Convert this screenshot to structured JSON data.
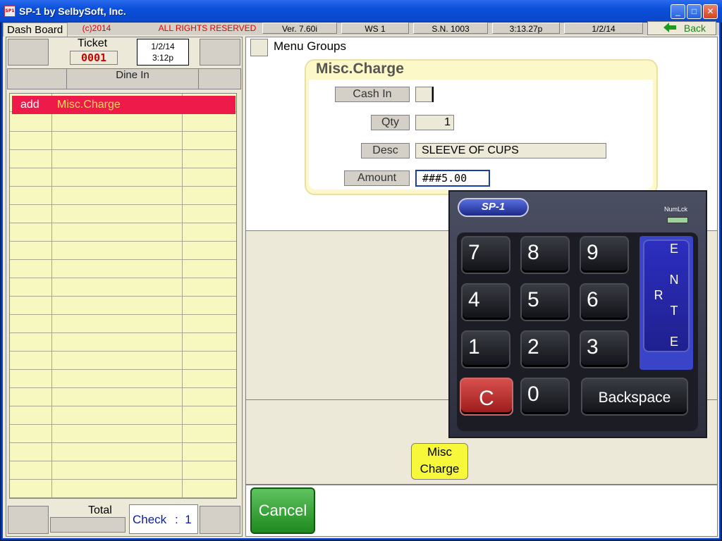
{
  "window": {
    "title": "SP-1 by SelbySoft, Inc.",
    "icon_text": "SP1",
    "minimize": "_",
    "maximize": "□",
    "close": "✕"
  },
  "statusbar": {
    "tab": "Dash Board",
    "copyright": "(c)2014",
    "rights": "ALL RIGHTS RESERVED",
    "version": "Ver. 7.60i",
    "workstation": "WS  1",
    "serial": "S.N. 1003",
    "time": "3:13.27p",
    "date": "1/2/14",
    "back": "Back"
  },
  "ticket": {
    "label": "Ticket",
    "number": "0001",
    "date": "1/2/14",
    "time": "3:12p",
    "service": "Dine In"
  },
  "order": {
    "selected_action": "add",
    "selected_item": "Misc.Charge"
  },
  "footer": {
    "total_label": "Total",
    "check_label": "Check",
    "check_sep": ":",
    "check_number": "1"
  },
  "menu": {
    "groups_label": "Menu Groups"
  },
  "dialog": {
    "title": "Misc.Charge",
    "cash_in_label": "Cash In",
    "qty_label": "Qty",
    "qty_value": "1",
    "desc_label": "Desc",
    "desc_value": "SLEEVE OF CUPS",
    "amount_label": "Amount",
    "amount_value": "###5.00"
  },
  "keypad": {
    "brand": "SP-1",
    "numlock": "NumLck",
    "keys": [
      "7",
      "8",
      "9",
      "4",
      "5",
      "6",
      "1",
      "2",
      "3",
      "0"
    ],
    "clear": "C",
    "backspace": "Backspace",
    "enter": "E N T E R"
  },
  "buttons": {
    "misc_line1": "Misc",
    "misc_line2": "Charge",
    "cancel": "Cancel"
  },
  "colors": {
    "selected_row": "#ee1a4a",
    "order_bg": "#f7f7c0",
    "cancel": "#2a9a2a",
    "misc_button": "#f8f83a"
  }
}
